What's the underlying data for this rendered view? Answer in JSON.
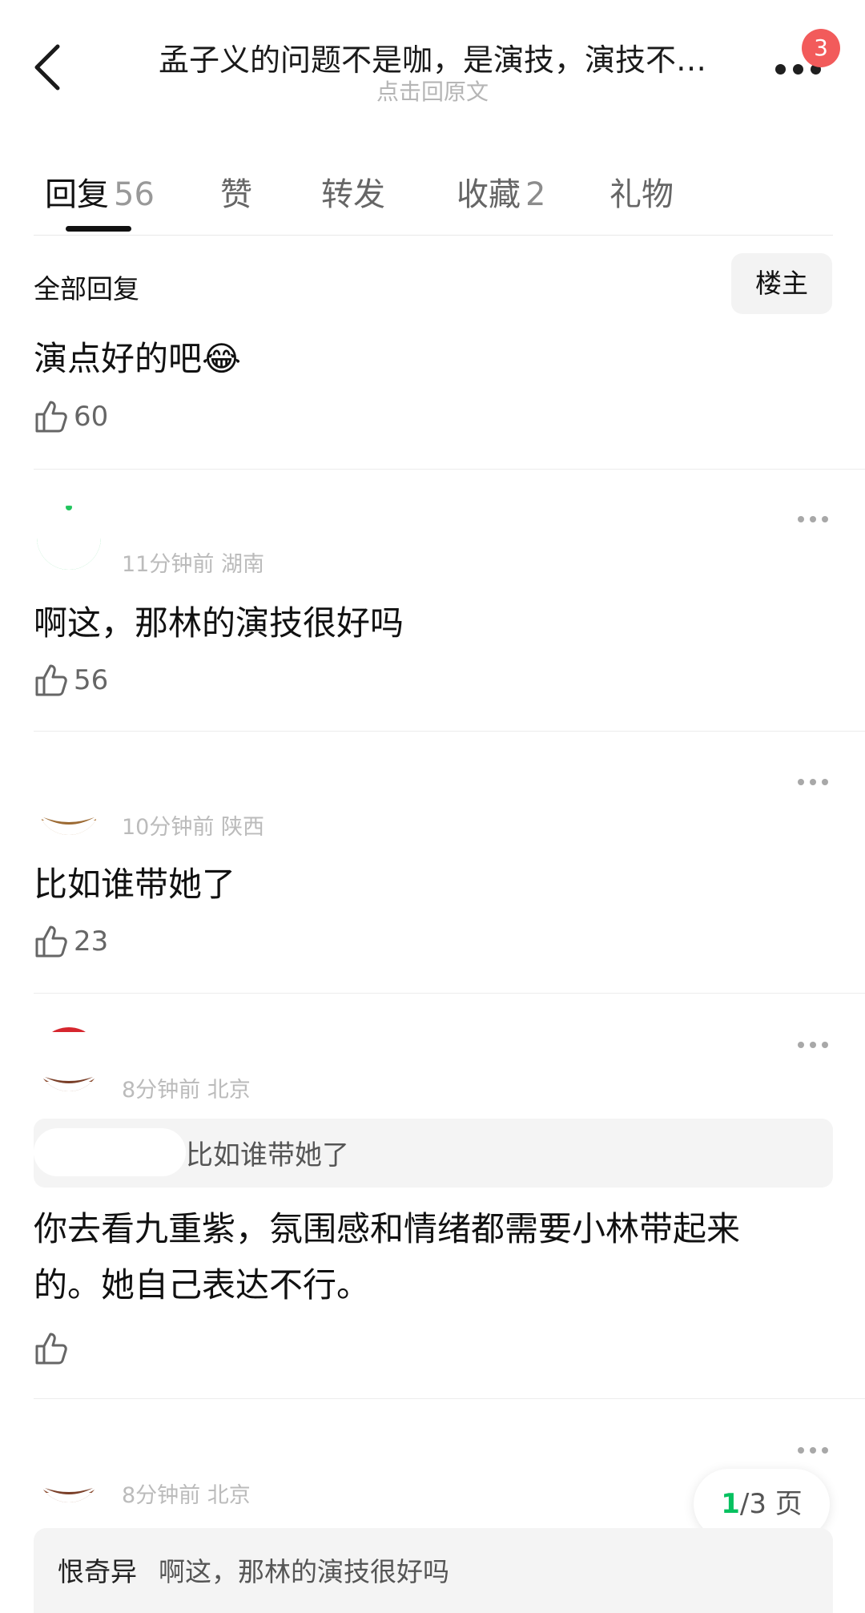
{
  "header": {
    "title": "孟子义的问题不是咖，是演技，演技不…",
    "subtitle": "点击回原文",
    "notification_count": "3"
  },
  "tabs": [
    {
      "label": "回复",
      "count": "56",
      "active": true
    },
    {
      "label": "赞",
      "count": ""
    },
    {
      "label": "转发",
      "count": ""
    },
    {
      "label": "收藏",
      "count": "2"
    },
    {
      "label": "礼物",
      "count": ""
    }
  ],
  "filter": {
    "all_replies_label": "全部回复",
    "op_button_label": "楼主"
  },
  "comments": [
    {
      "text": "演点好的吧😂",
      "likes": "60"
    },
    {
      "meta": "11分钟前 湖南",
      "text": "啊这，那林的演技很好吗",
      "likes": "56"
    },
    {
      "meta": "10分钟前 陕西",
      "text": "比如谁带她了",
      "likes": "23"
    },
    {
      "meta": "8分钟前 北京",
      "quote": "比如谁带她了",
      "text": "你去看九重紫，氛围感和情绪都需要小林带起来的。她自己表达不行。",
      "likes": ""
    },
    {
      "meta": "8分钟前 北京",
      "quote_user": "恨奇异",
      "quote": "啊这，那林的演技很好吗"
    }
  ],
  "pager": {
    "current": "1",
    "total_label": "/3 页"
  },
  "colors": {
    "accent": "#07c160",
    "badge": "#f25b5b",
    "divider": "#ececec"
  }
}
